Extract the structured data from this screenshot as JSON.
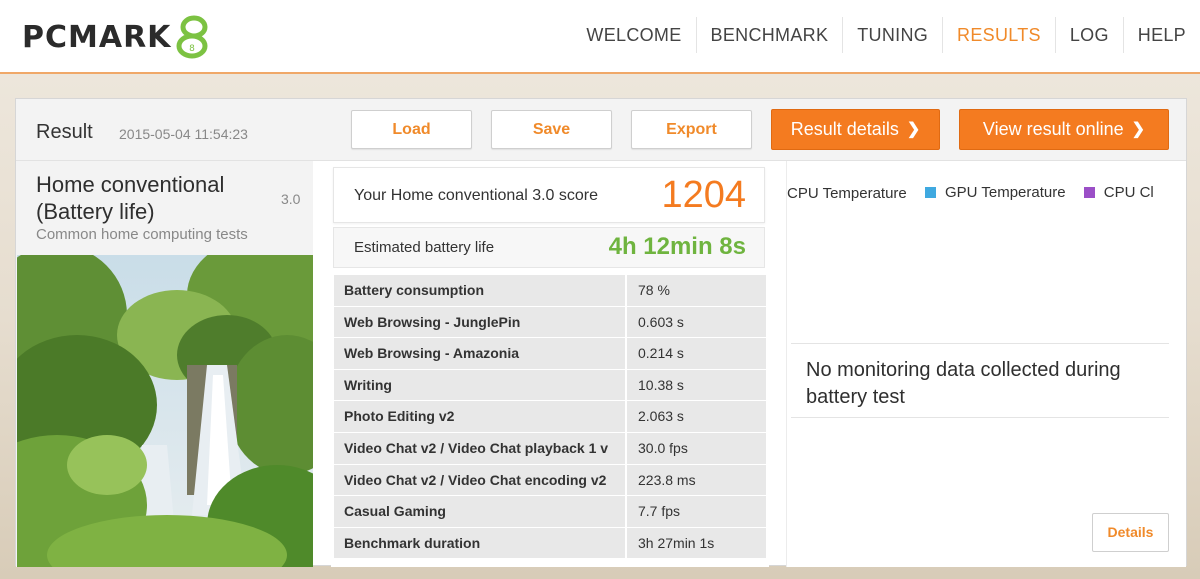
{
  "header": {
    "logo_text": "PCMARK",
    "logo_number": "8",
    "nav": [
      {
        "label": "WELCOME",
        "active": false
      },
      {
        "label": "BENCHMARK",
        "active": false
      },
      {
        "label": "TUNING",
        "active": false
      },
      {
        "label": "RESULTS",
        "active": true
      },
      {
        "label": "LOG",
        "active": false
      },
      {
        "label": "HELP",
        "active": false
      }
    ]
  },
  "toolbar": {
    "title": "Result",
    "date": "2015-05-04 11:54:23",
    "load_label": "Load",
    "save_label": "Save",
    "export_label": "Export",
    "result_details_label": "Result details",
    "view_online_label": "View result online"
  },
  "test": {
    "name": "Home conventional (Battery life)",
    "version": "3.0",
    "description": "Common home computing tests"
  },
  "score": {
    "label": "Your Home conventional 3.0 score",
    "value": "1204",
    "battery_label": "Estimated battery life",
    "battery_value": "4h 12min 8s"
  },
  "results": [
    {
      "name": "Battery consumption",
      "value": "78 %"
    },
    {
      "name": "Web Browsing - JunglePin",
      "value": "0.603 s"
    },
    {
      "name": "Web Browsing - Amazonia",
      "value": "0.214 s"
    },
    {
      "name": "Writing",
      "value": "10.38 s"
    },
    {
      "name": "Photo Editing v2",
      "value": "2.063 s"
    },
    {
      "name": "Video Chat v2 / Video Chat playback 1 v",
      "value": "30.0 fps"
    },
    {
      "name": "Video Chat v2 / Video Chat encoding v2",
      "value": "223.8 ms"
    },
    {
      "name": "Casual Gaming",
      "value": "7.7 fps"
    },
    {
      "name": "Benchmark duration",
      "value": "3h 27min 1s"
    }
  ],
  "monitoring": {
    "legend": [
      {
        "label": "CPU Temperature",
        "color": "#f47b20"
      },
      {
        "label": "GPU Temperature",
        "color": "#3fa9e0"
      },
      {
        "label": "CPU Cl",
        "color": "#9b4fc7"
      }
    ],
    "no_data_text": "No monitoring data collected during battery test",
    "details_label": "Details"
  },
  "colors": {
    "accent": "#f47b20",
    "battery_green": "#6fb43f",
    "logo_green": "#7cc242"
  }
}
